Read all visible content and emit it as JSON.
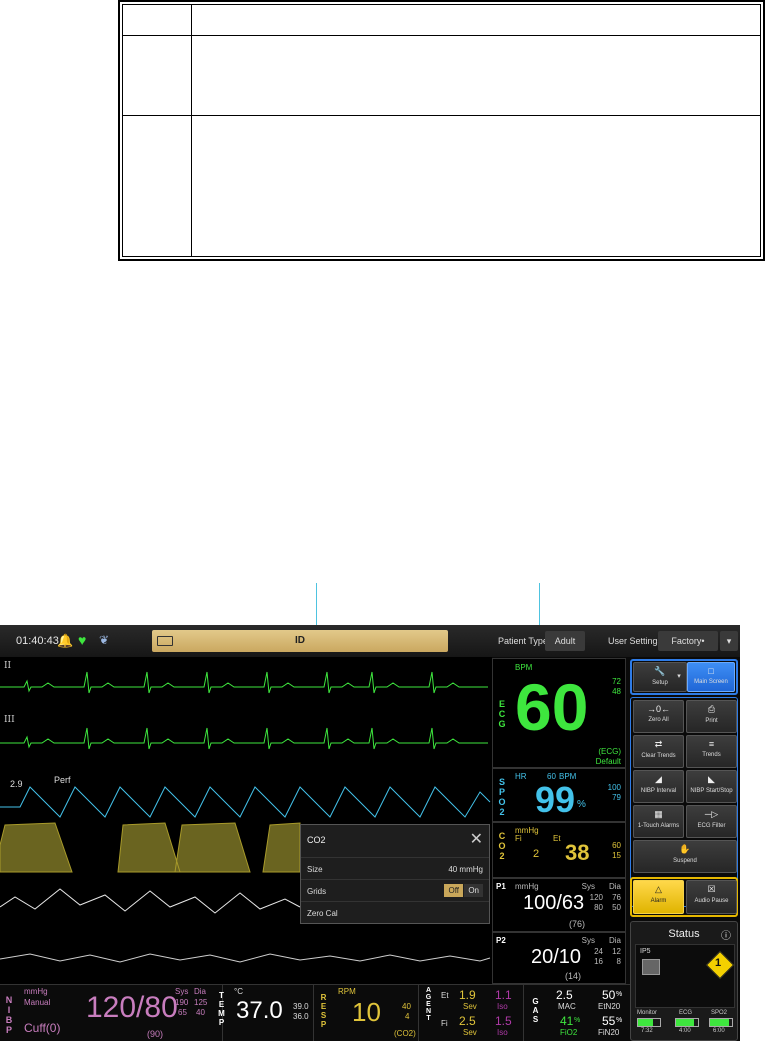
{
  "monitor": {
    "time": "01:40:43",
    "id_label": "ID",
    "patient_type_label": "Patient Type",
    "patient_type_value": "Adult",
    "user_settings_label": "User Settings",
    "user_settings_value": "Factory•",
    "colors": {
      "ecg": "#3ee63e",
      "spo2": "#43c2ea",
      "co2": "#e0c43a",
      "nibp": "#c87dbe",
      "resp": "#e0c43a",
      "temp": "#ffffff",
      "agent": "#e0c43a",
      "gas": "#ffffff"
    }
  },
  "waves": {
    "lead_ii": "II",
    "lead_iii": "III",
    "pleth_value": "2.9",
    "pleth_label": "Perf"
  },
  "ecg": {
    "label": "ECG",
    "unit": "BPM",
    "value": "60",
    "high": "72",
    "low": "48",
    "source": "(ECG)",
    "mode": "Default"
  },
  "spo2": {
    "label": "SPO2",
    "hr_label": "HR",
    "hr_value": "60",
    "unit": "BPM",
    "value": "99",
    "pct": "%",
    "high": "100",
    "low": "79"
  },
  "co2": {
    "label": "CO2",
    "unit": "mmHg",
    "fi_label": "Fi",
    "et_label": "Et",
    "fi_value": "2",
    "et_value": "38",
    "high": "60",
    "low": "15"
  },
  "p1": {
    "label": "P1",
    "unit": "mmHg",
    "sys_label": "Sys",
    "dia_label": "Dia",
    "value": "100/63",
    "mean": "(76)",
    "sys_high": "120",
    "dia_high": "76",
    "sys_low": "80",
    "dia_low": "50"
  },
  "p2": {
    "label": "P2",
    "sys_label": "Sys",
    "dia_label": "Dia",
    "value": "20/10",
    "mean": "(14)",
    "sys_high": "24",
    "dia_high": "12",
    "sys_low": "16",
    "dia_low": "8"
  },
  "popup": {
    "title": "CO2",
    "size_label": "Size",
    "size_value": "40 mmHg",
    "grids_label": "Grids",
    "grids_off": "Off",
    "grids_on": "On",
    "zero_cal_label": "Zero Cal"
  },
  "sidebar": {
    "setup": "Setup",
    "main_screen": "Main Screen",
    "zero_all": "Zero All",
    "print": "Print",
    "clear_trends": "Clear Trends",
    "trends": "Trends",
    "nibp_interval": "NIBP Interval",
    "nibp_start_stop": "NIBP Start/Stop",
    "one_touch_alarms": "1-Touch Alarms",
    "ecg_filter": "ECG Filter",
    "suspend": "Suspend",
    "alarm": "Alarm",
    "audio_pause": "Audio Pause",
    "status_title": "Status",
    "status_device": "IP5",
    "status_badge": "1",
    "batt_monitor": "Monitor",
    "batt_monitor_time": "7:32",
    "batt_ecg": "ECG",
    "batt_ecg_time": "4:00",
    "batt_spo2": "SPO2",
    "batt_spo2_time": "6:00"
  },
  "nibp": {
    "label": "NIBP",
    "unit": "mmHg",
    "mode": "Manual",
    "cuff": "Cuff(0)",
    "value": "120/80",
    "mean": "(90)",
    "sys_label": "Sys",
    "dia_label": "Dia",
    "sys_high": "190",
    "dia_high": "125",
    "sys_low": "65",
    "dia_low": "40"
  },
  "temp": {
    "label": "TEMP",
    "unit": "°C",
    "value": "37.0",
    "high": "39.0",
    "low": "36.0"
  },
  "resp": {
    "label": "RESP",
    "unit": "RPM",
    "value": "10",
    "high": "40",
    "low": "4",
    "source": "(CO2)"
  },
  "agent": {
    "label": "AGENT",
    "et_label": "Et",
    "fi_label": "Fi",
    "sev_et": "1.9",
    "sev_fi": "2.5",
    "sev_name": "Sev",
    "iso_et": "1.1",
    "iso_fi": "1.5",
    "iso_name": "Iso"
  },
  "gas": {
    "label": "GAS",
    "mac_value": "2.5",
    "mac_label": "MAC",
    "etn2o_value": "50",
    "etn2o_label": "EtN20",
    "fio2_value": "41",
    "fio2_label": "FiO2",
    "fin2o_value": "55",
    "fin2o_label": "FiN20",
    "pct": "%"
  }
}
